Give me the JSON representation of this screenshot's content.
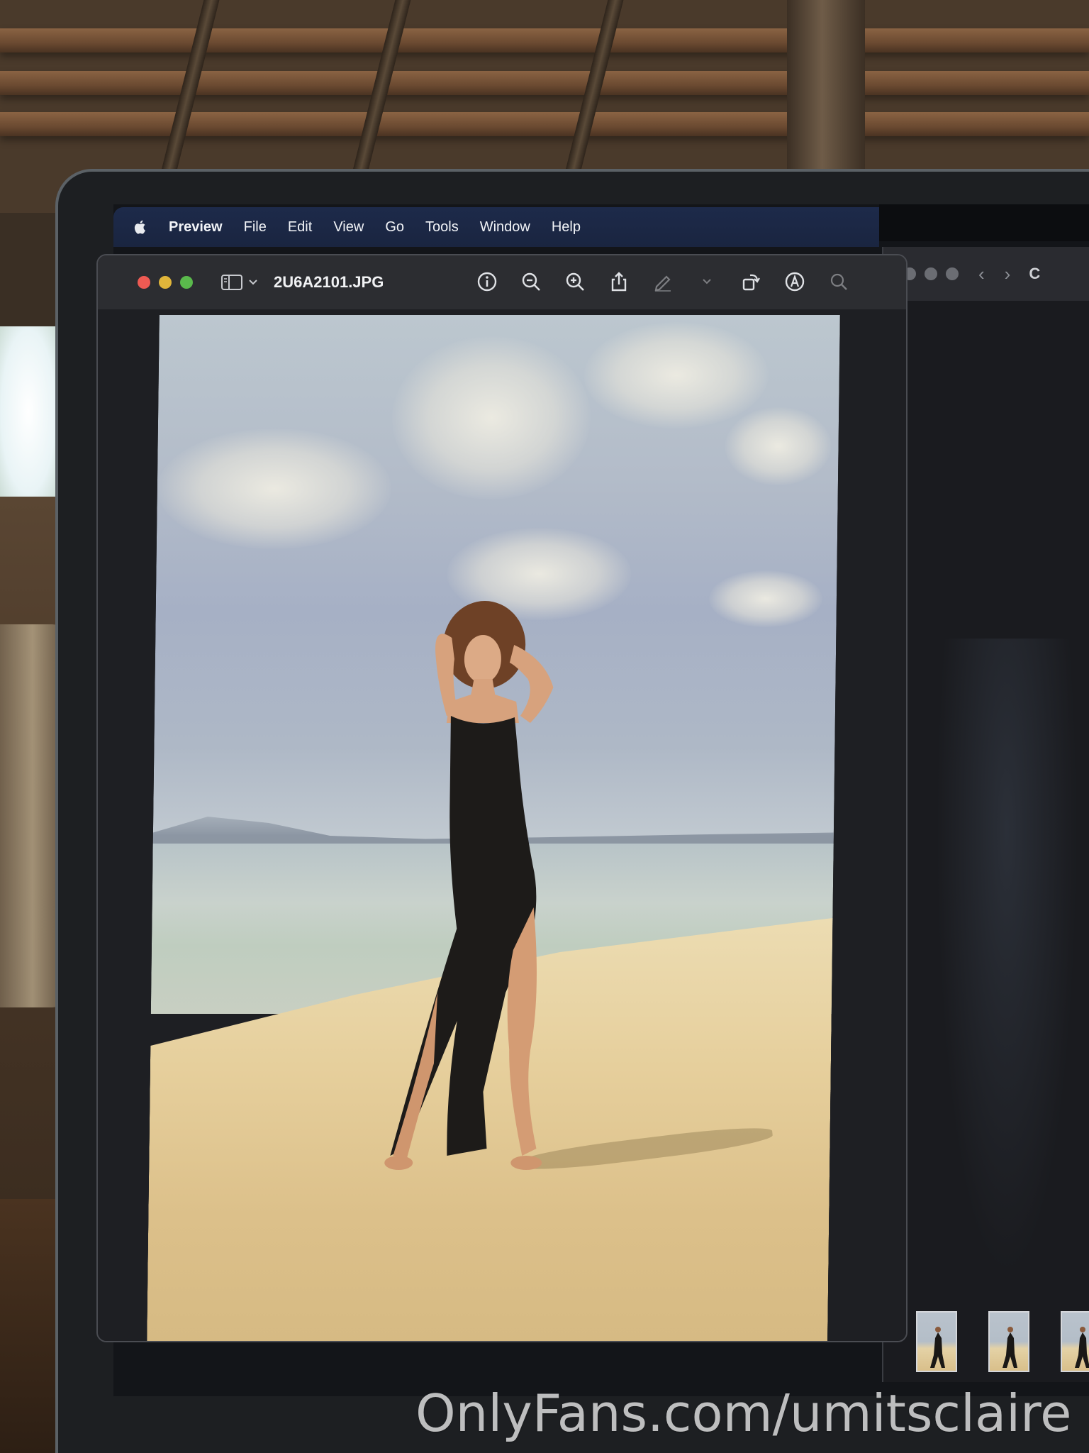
{
  "menubar": {
    "app_name": "Preview",
    "items": [
      "File",
      "Edit",
      "View",
      "Go",
      "Tools",
      "Window",
      "Help"
    ]
  },
  "preview_window": {
    "title": "2U6A2101.JPG",
    "toolbar_icons": [
      "info-icon",
      "zoom-out-icon",
      "zoom-in-icon",
      "share-icon",
      "markup-pen-icon",
      "chevron-down-icon",
      "rotate-icon",
      "annotate-icon",
      "search-icon"
    ]
  },
  "side_window": {
    "partial_title": "C"
  },
  "watermark": {
    "text": "OnlyFans.com/umitsclaire"
  },
  "colors": {
    "menubar": "#1d2a4a",
    "traffic_red": "#ee5a53",
    "traffic_yellow": "#e0b53a",
    "traffic_green": "#5ab94c"
  }
}
